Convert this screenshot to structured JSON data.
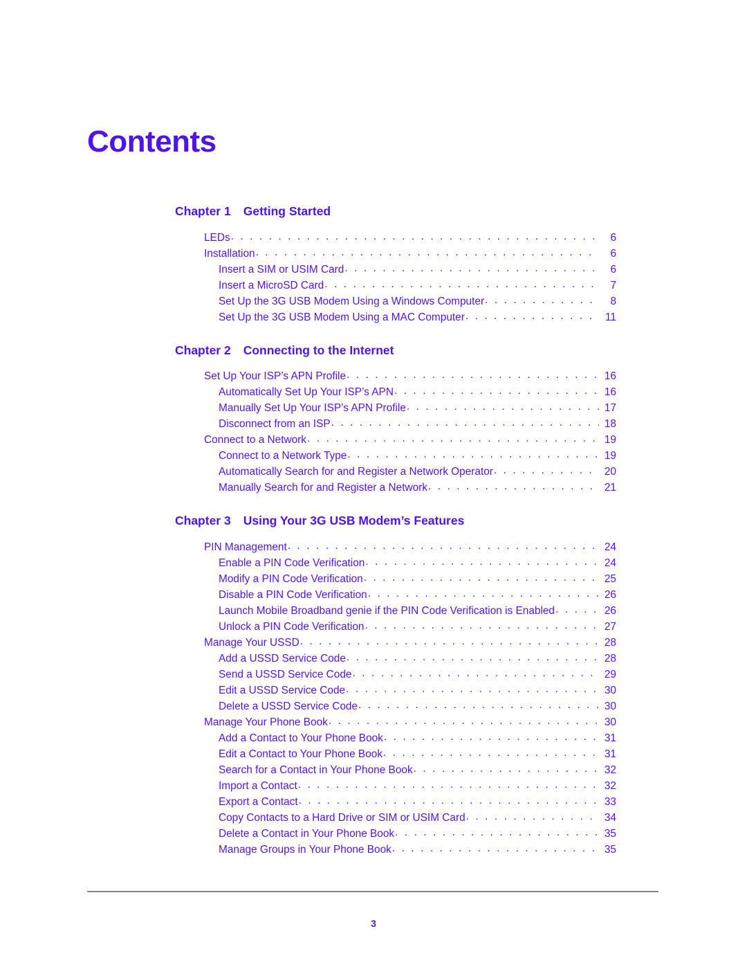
{
  "document": {
    "title": "Contents",
    "page_number": "3",
    "accent_color": "#4f14e8",
    "entry_color": "#5416e6",
    "rule_color": "#828282",
    "dot_leader": ". . . . . . . . . . . . . . . . . . . . . . . . . . . . . . . . . . . . . . . . . . . . . . . . . . . . . . . . . . . . . . . . . . . . . . . . . . . . . . . . . . . . . . . . . . ."
  },
  "chapters": [
    {
      "label": "Chapter 1",
      "title": "Getting Started",
      "entries": [
        {
          "level": 1,
          "text": "LEDs",
          "page": "6"
        },
        {
          "level": 1,
          "text": "Installation",
          "page": "6"
        },
        {
          "level": 2,
          "text": "Insert a SIM or USIM Card",
          "page": "6"
        },
        {
          "level": 2,
          "text": "Insert a MicroSD Card",
          "page": "7"
        },
        {
          "level": 2,
          "text": "Set Up the 3G USB Modem Using a Windows Computer",
          "page": "8"
        },
        {
          "level": 2,
          "text": "Set Up the 3G USB Modem Using a MAC Computer",
          "page": "11"
        }
      ]
    },
    {
      "label": "Chapter 2",
      "title": "Connecting to the Internet",
      "entries": [
        {
          "level": 1,
          "text": "Set Up Your ISP’s APN Profile",
          "page": "16"
        },
        {
          "level": 2,
          "text": "Automatically Set Up Your ISP’s APN",
          "page": "16"
        },
        {
          "level": 2,
          "text": "Manually Set Up Your ISP’s APN Profile",
          "page": "17"
        },
        {
          "level": 2,
          "text": "Disconnect from an ISP",
          "page": "18"
        },
        {
          "level": 1,
          "text": "Connect to a Network",
          "page": "19"
        },
        {
          "level": 2,
          "text": "Connect to a Network Type",
          "page": "19"
        },
        {
          "level": 2,
          "text": "Automatically Search for and Register a Network Operator",
          "page": "20"
        },
        {
          "level": 2,
          "text": "Manually Search for and Register a Network",
          "page": "21"
        }
      ]
    },
    {
      "label": "Chapter 3",
      "title": "Using Your 3G USB Modem’s Features",
      "entries": [
        {
          "level": 1,
          "text": "PIN Management",
          "page": "24"
        },
        {
          "level": 2,
          "text": "Enable a PIN Code Verification",
          "page": "24"
        },
        {
          "level": 2,
          "text": "Modify a PIN Code Verification",
          "page": "25"
        },
        {
          "level": 2,
          "text": "Disable a PIN Code Verification",
          "page": "26"
        },
        {
          "level": 2,
          "text": "Launch Mobile Broadband genie if the PIN Code Verification is Enabled",
          "page": "26"
        },
        {
          "level": 2,
          "text": "Unlock a PIN Code Verification",
          "page": "27"
        },
        {
          "level": 1,
          "text": "Manage Your USSD",
          "page": "28"
        },
        {
          "level": 2,
          "text": "Add a USSD Service Code",
          "page": "28"
        },
        {
          "level": 2,
          "text": "Send a USSD Service Code",
          "page": "29"
        },
        {
          "level": 2,
          "text": "Edit a USSD Service Code",
          "page": "30"
        },
        {
          "level": 2,
          "text": "Delete a USSD Service Code",
          "page": "30"
        },
        {
          "level": 1,
          "text": "Manage Your Phone Book",
          "page": "30"
        },
        {
          "level": 2,
          "text": "Add a Contact to Your Phone Book",
          "page": "31"
        },
        {
          "level": 2,
          "text": "Edit a Contact to Your Phone Book",
          "page": "31"
        },
        {
          "level": 2,
          "text": "Search for a Contact in Your Phone Book",
          "page": "32"
        },
        {
          "level": 2,
          "text": "Import a Contact",
          "page": "32"
        },
        {
          "level": 2,
          "text": "Export a Contact",
          "page": "33"
        },
        {
          "level": 2,
          "text": "Copy Contacts to a Hard Drive or SIM or USIM Card",
          "page": "34"
        },
        {
          "level": 2,
          "text": "Delete a Contact in Your Phone Book",
          "page": "35"
        },
        {
          "level": 2,
          "text": "Manage Groups in Your Phone Book",
          "page": "35"
        }
      ]
    }
  ]
}
